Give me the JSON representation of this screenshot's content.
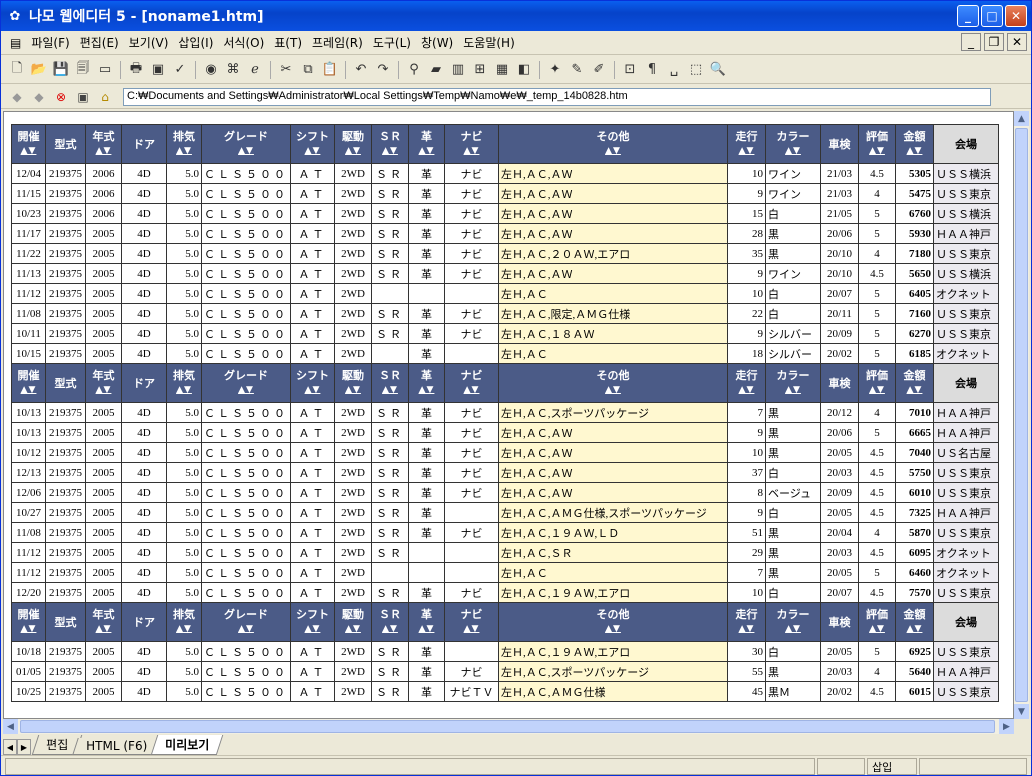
{
  "window": {
    "title": "나모 웹에디터 5 - [noname1.htm]",
    "min": "_",
    "max": "□",
    "close": "✕"
  },
  "menu": [
    "파일(F)",
    "편집(E)",
    "보기(V)",
    "삽입(I)",
    "서식(O)",
    "표(T)",
    "프레임(R)",
    "도구(L)",
    "창(W)",
    "도움말(H)"
  ],
  "mdi": {
    "min": "_",
    "restore": "❐",
    "close": "✕"
  },
  "address": {
    "value": "C:₩Documents and Settings₩Administrator₩Local Settings₩Temp₩Namo₩e₩_temp_14b0828.htm"
  },
  "headers": [
    "開催",
    "型式",
    "年式",
    "ドア",
    "排気",
    "グレード",
    "シフト",
    "駆動",
    "ＳＲ",
    "革",
    "ナビ",
    "その他",
    "走行",
    "カラー",
    "車検",
    "評価",
    "金額",
    "会場"
  ],
  "sort_mark": "▲▼",
  "groups": [
    [
      [
        "12/04",
        "219375",
        "2006",
        "4D",
        "5.0",
        "ＣＬＳ５００",
        "ＡＴ",
        "2WD",
        "ＳＲ",
        "革",
        "ナビ",
        "左Ｈ,ＡＣ,ＡＷ",
        "10",
        "ワイン",
        "21/03",
        "4.5",
        "5305",
        "ＵＳＳ横浜"
      ],
      [
        "11/15",
        "219375",
        "2006",
        "4D",
        "5.0",
        "ＣＬＳ５００",
        "ＡＴ",
        "2WD",
        "ＳＲ",
        "革",
        "ナビ",
        "左Ｈ,ＡＣ,ＡＷ",
        "9",
        "ワイン",
        "21/03",
        "4",
        "5475",
        "ＵＳＳ東京"
      ],
      [
        "10/23",
        "219375",
        "2006",
        "4D",
        "5.0",
        "ＣＬＳ５００",
        "ＡＴ",
        "2WD",
        "ＳＲ",
        "革",
        "ナビ",
        "左Ｈ,ＡＣ,ＡＷ",
        "15",
        "白",
        "21/05",
        "5",
        "6760",
        "ＵＳＳ横浜"
      ],
      [
        "11/17",
        "219375",
        "2005",
        "4D",
        "5.0",
        "ＣＬＳ５００",
        "ＡＴ",
        "2WD",
        "ＳＲ",
        "革",
        "ナビ",
        "左Ｈ,ＡＣ,ＡＷ",
        "28",
        "黒",
        "20/06",
        "5",
        "5930",
        "ＨＡＡ神戸"
      ],
      [
        "11/22",
        "219375",
        "2005",
        "4D",
        "5.0",
        "ＣＬＳ５００",
        "ＡＴ",
        "2WD",
        "ＳＲ",
        "革",
        "ナビ",
        "左Ｈ,ＡＣ,２０ＡＷ,エアロ",
        "35",
        "黒",
        "20/10",
        "4",
        "7180",
        "ＵＳＳ東京"
      ],
      [
        "11/13",
        "219375",
        "2005",
        "4D",
        "5.0",
        "ＣＬＳ５００",
        "ＡＴ",
        "2WD",
        "ＳＲ",
        "革",
        "ナビ",
        "左Ｈ,ＡＣ,ＡＷ",
        "9",
        "ワイン",
        "20/10",
        "4.5",
        "5650",
        "ＵＳＳ横浜"
      ],
      [
        "11/12",
        "219375",
        "2005",
        "4D",
        "5.0",
        "ＣＬＳ５００",
        "ＡＴ",
        "2WD",
        "",
        "",
        "",
        "左Ｈ,ＡＣ",
        "10",
        "白",
        "20/07",
        "5",
        "6405",
        "オクネット"
      ],
      [
        "11/08",
        "219375",
        "2005",
        "4D",
        "5.0",
        "ＣＬＳ５００",
        "ＡＴ",
        "2WD",
        "ＳＲ",
        "革",
        "ナビ",
        "左Ｈ,ＡＣ,限定,ＡＭＧ仕様",
        "22",
        "白",
        "20/11",
        "5",
        "7160",
        "ＵＳＳ東京"
      ],
      [
        "10/11",
        "219375",
        "2005",
        "4D",
        "5.0",
        "ＣＬＳ５００",
        "ＡＴ",
        "2WD",
        "ＳＲ",
        "革",
        "ナビ",
        "左Ｈ,ＡＣ,１８ＡＷ",
        "9",
        "シルバー",
        "20/09",
        "5",
        "6270",
        "ＵＳＳ東京"
      ],
      [
        "10/15",
        "219375",
        "2005",
        "4D",
        "5.0",
        "ＣＬＳ５００",
        "ＡＴ",
        "2WD",
        "",
        "革",
        "",
        "左Ｈ,ＡＣ",
        "18",
        "シルバー",
        "20/02",
        "5",
        "6185",
        "オクネット"
      ]
    ],
    [
      [
        "10/13",
        "219375",
        "2005",
        "4D",
        "5.0",
        "ＣＬＳ５００",
        "ＡＴ",
        "2WD",
        "ＳＲ",
        "革",
        "ナビ",
        "左Ｈ,ＡＣ,スポーツパッケージ",
        "7",
        "黒",
        "20/12",
        "4",
        "7010",
        "ＨＡＡ神戸"
      ],
      [
        "10/13",
        "219375",
        "2005",
        "4D",
        "5.0",
        "ＣＬＳ５００",
        "ＡＴ",
        "2WD",
        "ＳＲ",
        "革",
        "ナビ",
        "左Ｈ,ＡＣ,ＡＷ",
        "9",
        "黒",
        "20/06",
        "5",
        "6665",
        "ＨＡＡ神戸"
      ],
      [
        "10/12",
        "219375",
        "2005",
        "4D",
        "5.0",
        "ＣＬＳ５００",
        "ＡＴ",
        "2WD",
        "ＳＲ",
        "革",
        "ナビ",
        "左Ｈ,ＡＣ,ＡＷ",
        "10",
        "黒",
        "20/05",
        "4.5",
        "7040",
        "ＵＳ名古屋"
      ],
      [
        "12/13",
        "219375",
        "2005",
        "4D",
        "5.0",
        "ＣＬＳ５００",
        "ＡＴ",
        "2WD",
        "ＳＲ",
        "革",
        "ナビ",
        "左Ｈ,ＡＣ,ＡＷ",
        "37",
        "白",
        "20/03",
        "4.5",
        "5750",
        "ＵＳＳ東京"
      ],
      [
        "12/06",
        "219375",
        "2005",
        "4D",
        "5.0",
        "ＣＬＳ５００",
        "ＡＴ",
        "2WD",
        "ＳＲ",
        "革",
        "ナビ",
        "左Ｈ,ＡＣ,ＡＷ",
        "8",
        "ベージュ",
        "20/09",
        "4.5",
        "6010",
        "ＵＳＳ東京"
      ],
      [
        "10/27",
        "219375",
        "2005",
        "4D",
        "5.0",
        "ＣＬＳ５００",
        "ＡＴ",
        "2WD",
        "ＳＲ",
        "革",
        "",
        "左Ｈ,ＡＣ,ＡＭＧ仕様,スポーツパッケージ",
        "9",
        "白",
        "20/05",
        "4.5",
        "7325",
        "ＨＡＡ神戸"
      ],
      [
        "11/08",
        "219375",
        "2005",
        "4D",
        "5.0",
        "ＣＬＳ５００",
        "ＡＴ",
        "2WD",
        "ＳＲ",
        "革",
        "ナビ",
        "左Ｈ,ＡＣ,１９ＡＷ,ＬＤ",
        "51",
        "黒",
        "20/04",
        "4",
        "5870",
        "ＵＳＳ東京"
      ],
      [
        "11/12",
        "219375",
        "2005",
        "4D",
        "5.0",
        "ＣＬＳ５００",
        "ＡＴ",
        "2WD",
        "ＳＲ",
        "",
        "",
        "左Ｈ,ＡＣ,ＳＲ",
        "29",
        "黒",
        "20/03",
        "4.5",
        "6095",
        "オクネット"
      ],
      [
        "11/12",
        "219375",
        "2005",
        "4D",
        "5.0",
        "ＣＬＳ５００",
        "ＡＴ",
        "2WD",
        "",
        "",
        "",
        "左Ｈ,ＡＣ",
        "7",
        "黒",
        "20/05",
        "5",
        "6460",
        "オクネット"
      ],
      [
        "12/20",
        "219375",
        "2005",
        "4D",
        "5.0",
        "ＣＬＳ５００",
        "ＡＴ",
        "2WD",
        "ＳＲ",
        "革",
        "ナビ",
        "左Ｈ,ＡＣ,１９ＡＷ,エアロ",
        "10",
        "白",
        "20/07",
        "4.5",
        "7570",
        "ＵＳＳ東京"
      ]
    ],
    [
      [
        "10/18",
        "219375",
        "2005",
        "4D",
        "5.0",
        "ＣＬＳ５００",
        "ＡＴ",
        "2WD",
        "ＳＲ",
        "革",
        "",
        "左Ｈ,ＡＣ,１９ＡＷ,エアロ",
        "30",
        "白",
        "20/05",
        "5",
        "6925",
        "ＵＳＳ東京"
      ],
      [
        "01/05",
        "219375",
        "2005",
        "4D",
        "5.0",
        "ＣＬＳ５００",
        "ＡＴ",
        "2WD",
        "ＳＲ",
        "革",
        "ナビ",
        "左Ｈ,ＡＣ,スポーツパッケージ",
        "55",
        "黒",
        "20/03",
        "4",
        "5640",
        "ＨＡＡ神戸"
      ],
      [
        "10/25",
        "219375",
        "2005",
        "4D",
        "5.0",
        "ＣＬＳ５００",
        "ＡＴ",
        "2WD",
        "ＳＲ",
        "革",
        "ナビＴＶ",
        "左Ｈ,ＡＣ,ＡＭＧ仕様",
        "45",
        "黒Ｍ",
        "20/02",
        "4.5",
        "6015",
        "ＵＳＳ東京"
      ]
    ]
  ],
  "tabs": [
    "편집",
    "HTML (F6)",
    "미리보기"
  ],
  "status": {
    "insert": "삽입"
  }
}
